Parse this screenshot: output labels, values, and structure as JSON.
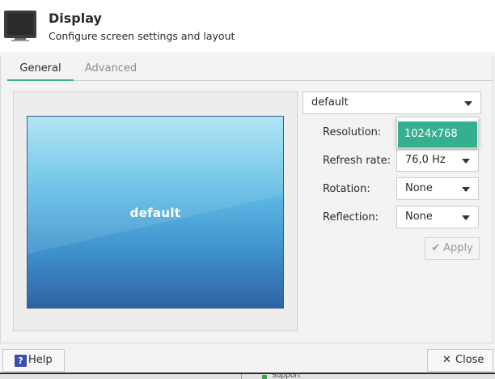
{
  "header": {
    "title": "Display",
    "subtitle": "Configure screen settings and layout",
    "icon": "monitor-icon"
  },
  "tabs": [
    {
      "label": "General",
      "active": true
    },
    {
      "label": "Advanced",
      "active": false
    }
  ],
  "preview": {
    "display_label": "default"
  },
  "settings": {
    "display_select": "default",
    "resolution": {
      "label": "Resolution:",
      "dropdown_open": true,
      "highlighted_option": "1024x768"
    },
    "refresh_rate": {
      "label": "Refresh rate:",
      "value": "76,0 Hz"
    },
    "rotation": {
      "label": "Rotation:",
      "value": "None"
    },
    "reflection": {
      "label": "Reflection:",
      "value": "None"
    },
    "apply_label": "Apply"
  },
  "buttons": {
    "help_label": "Help",
    "close_label": "Close"
  },
  "background_window": {
    "visible_text": "Support"
  },
  "colors": {
    "accent": "#35b08f",
    "help_icon": "#3b4fb3"
  }
}
